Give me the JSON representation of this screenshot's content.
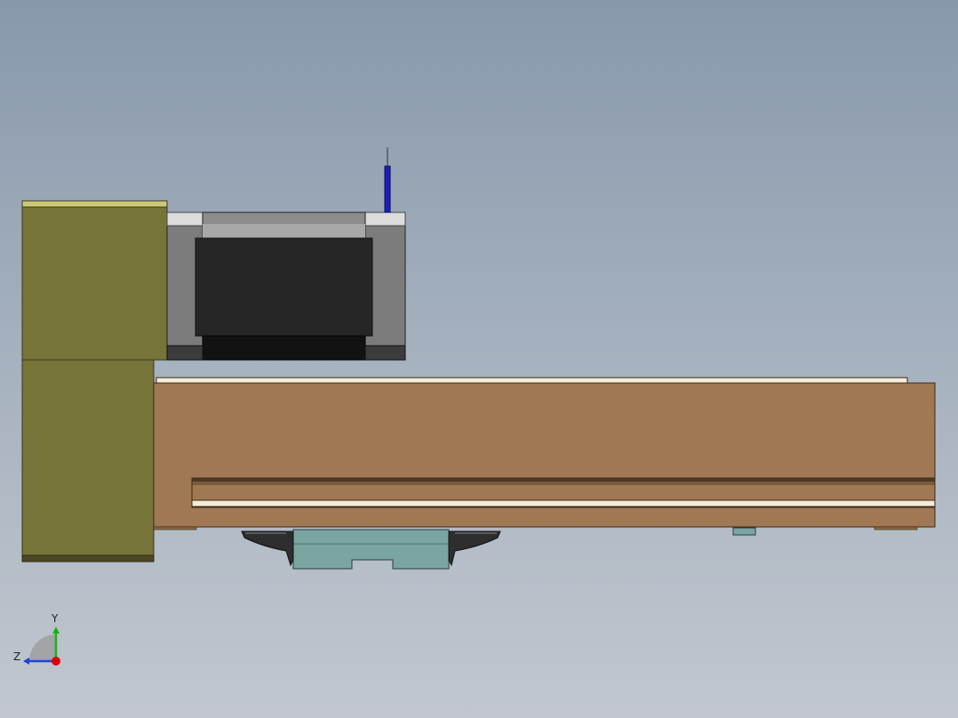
{
  "viewport": {
    "background_top": "#8898ab",
    "background_bottom": "#c2c7cf"
  },
  "model": {
    "parts": [
      {
        "name": "motor-mount-plate",
        "color": "#77743a"
      },
      {
        "name": "stepper-motor",
        "color": "#262626"
      },
      {
        "name": "motor-shaft",
        "color": "#1a20b8"
      },
      {
        "name": "linear-rail-base",
        "color": "#a07853"
      },
      {
        "name": "carriage-block",
        "color": "#7aa5a1"
      },
      {
        "name": "cable-clamp",
        "color": "#2e2e2e"
      }
    ]
  },
  "triad": {
    "y_label": "Y",
    "z_label": "Z",
    "x_axis_color": "#e00000",
    "y_axis_color": "#19b319",
    "z_axis_color": "#2040e0"
  }
}
